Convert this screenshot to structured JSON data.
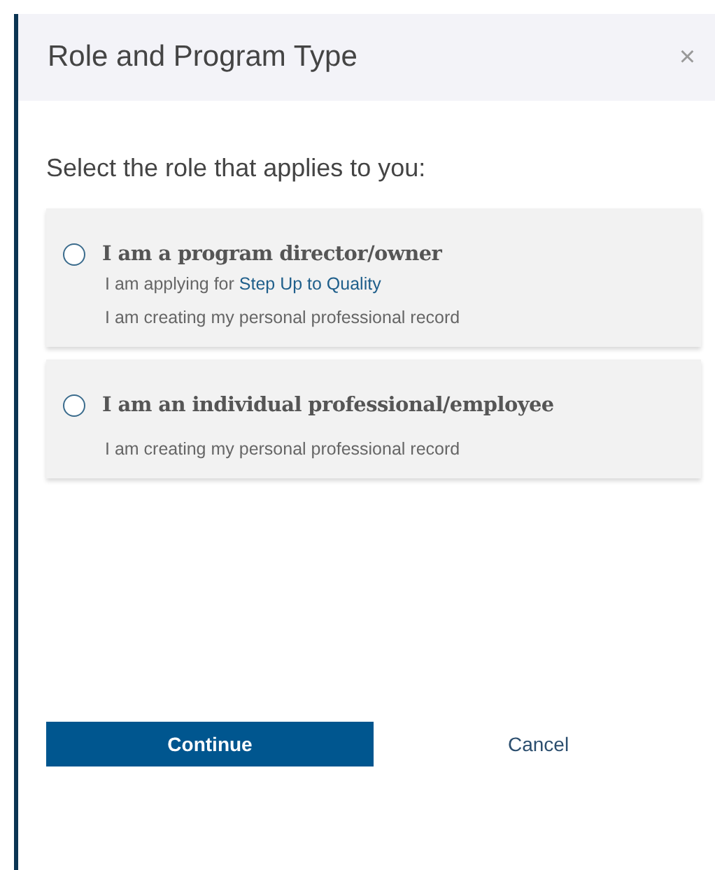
{
  "dialog": {
    "title": "Role and Program Type",
    "close": "×"
  },
  "prompt": "Select the role that applies to you:",
  "roles": [
    {
      "title": "I am a program director/owner",
      "selected": false,
      "lines": [
        {
          "text": "I am applying for ",
          "link": "Step Up to Quality"
        },
        {
          "text": "I am creating my personal professional record"
        }
      ]
    },
    {
      "title": "I am an individual professional/employee",
      "selected": false,
      "lines": [
        {
          "text": "I am creating my personal professional record"
        }
      ]
    }
  ],
  "buttons": [
    {
      "label": "Continue",
      "kind": "primary"
    },
    {
      "label": "Cancel",
      "kind": "link"
    }
  ]
}
